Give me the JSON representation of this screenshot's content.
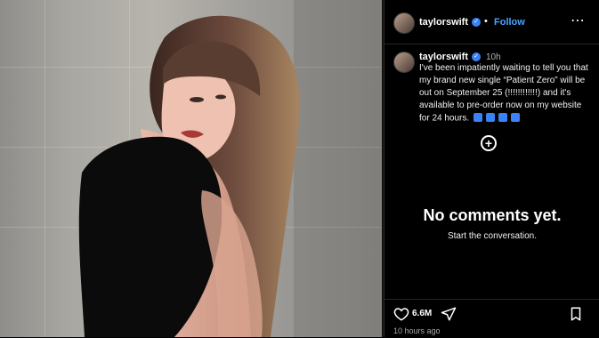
{
  "post": {
    "username": "taylorswift",
    "follow_label": "Follow",
    "dot_separator": "•",
    "more_label": "⋯",
    "caption_text": "I've been impatiently waiting to tell you that my brand new single “Patient Zero” will be out on September 25 (!!!!!!!!!!!!) and it's available to pre-order now on my website for 24 hours.",
    "post_time": "10h",
    "likes": "6.6M",
    "relative_time": "10 hours ago"
  },
  "comments": {
    "empty_title": "No comments yet.",
    "empty_subtitle": "Start the conversation."
  },
  "icons": {
    "verified": "verified-badge-icon",
    "add": "plus-circle-icon",
    "like": "heart-icon",
    "share": "paper-plane-icon",
    "save": "bookmark-icon"
  },
  "colors": {
    "background": "#000000",
    "accent": "#4aa3ff",
    "verified": "#3b82f6"
  }
}
